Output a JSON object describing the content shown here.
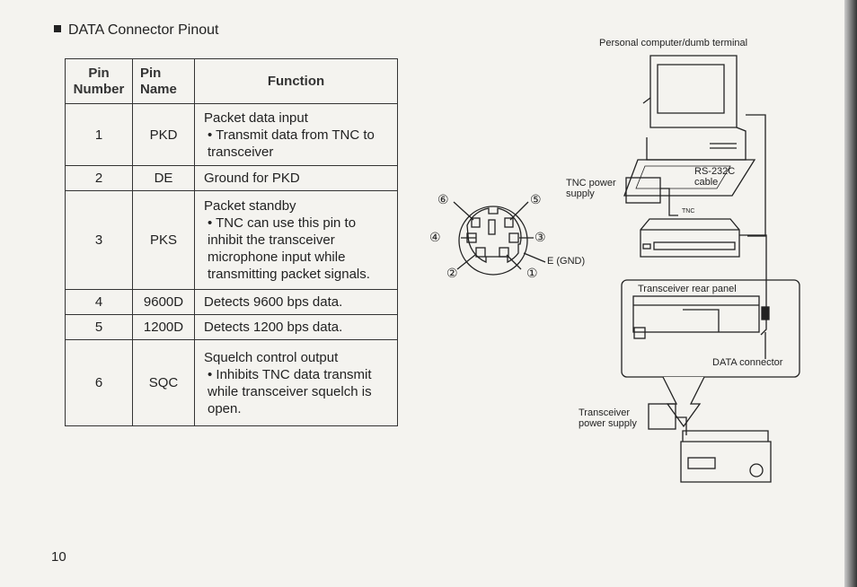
{
  "heading": "DATA Connector Pinout",
  "table": {
    "headers": [
      "Pin\nNumber",
      "Pin\nName",
      "Function"
    ],
    "rows": [
      {
        "number": "1",
        "name": "PKD",
        "title": "Packet data input",
        "bullet": "• Transmit data from TNC to transceiver"
      },
      {
        "number": "2",
        "name": "DE",
        "title": "Ground for PKD",
        "bullet": ""
      },
      {
        "number": "3",
        "name": "PKS",
        "title": "Packet standby",
        "bullet": "• TNC can use this pin to inhibit the transceiver microphone input while transmitting packet signals."
      },
      {
        "number": "4",
        "name": "9600D",
        "title": "Detects 9600 bps data.",
        "bullet": ""
      },
      {
        "number": "5",
        "name": "1200D",
        "title": "Detects 1200 bps data.",
        "bullet": ""
      },
      {
        "number": "6",
        "name": "SQC",
        "title": "Squelch control output",
        "bullet": "• Inhibits TNC data transmit while transceiver squelch is open."
      }
    ]
  },
  "diagram": {
    "computer": "Personal computer/dumb terminal",
    "tnc_power": "TNC power supply",
    "cable": "RS-232C cable",
    "tnc": "TNC",
    "rear_panel": "Transceiver rear panel",
    "data_connector": "DATA connector",
    "power_supply": "Transceiver power supply",
    "gnd": "E (GND)",
    "pins": [
      "①",
      "②",
      "③",
      "④",
      "⑤",
      "⑥"
    ]
  },
  "page_number": "10"
}
